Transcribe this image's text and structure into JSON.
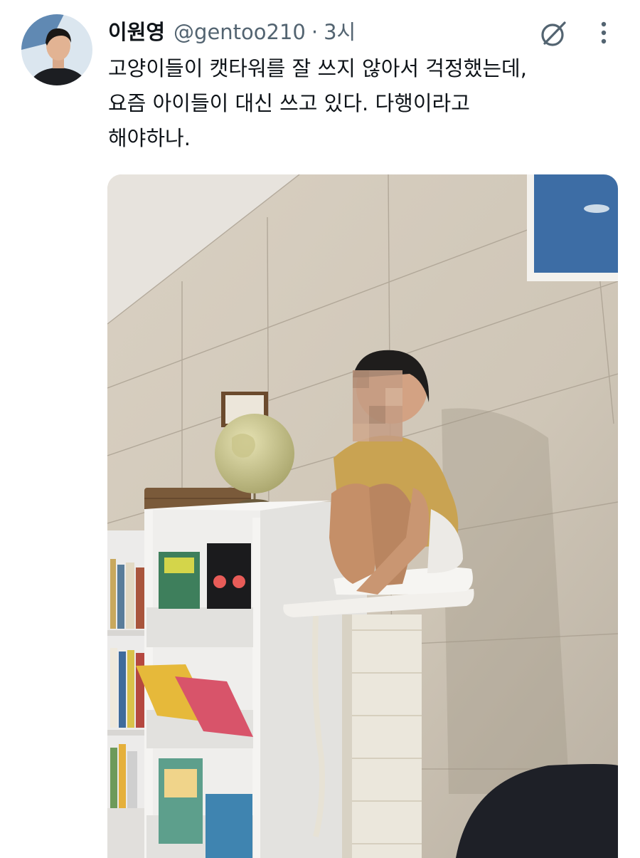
{
  "tweet": {
    "display_name": "이원영",
    "handle": "@gentoo210",
    "separator": "·",
    "time": "3시",
    "text": "고양이들이 캣타워를 잘 쓰지 않아서 걱정했는데,\n요즘 아이들이 대신 쓰고 있다. 다행이라고\n해야하나."
  },
  "icons": {
    "avatar": "user-avatar-photo",
    "grok": "grok-icon",
    "more": "more-vertical-icon"
  },
  "colors": {
    "text_primary": "#0f1419",
    "text_secondary": "#536471",
    "background": "#ffffff"
  }
}
